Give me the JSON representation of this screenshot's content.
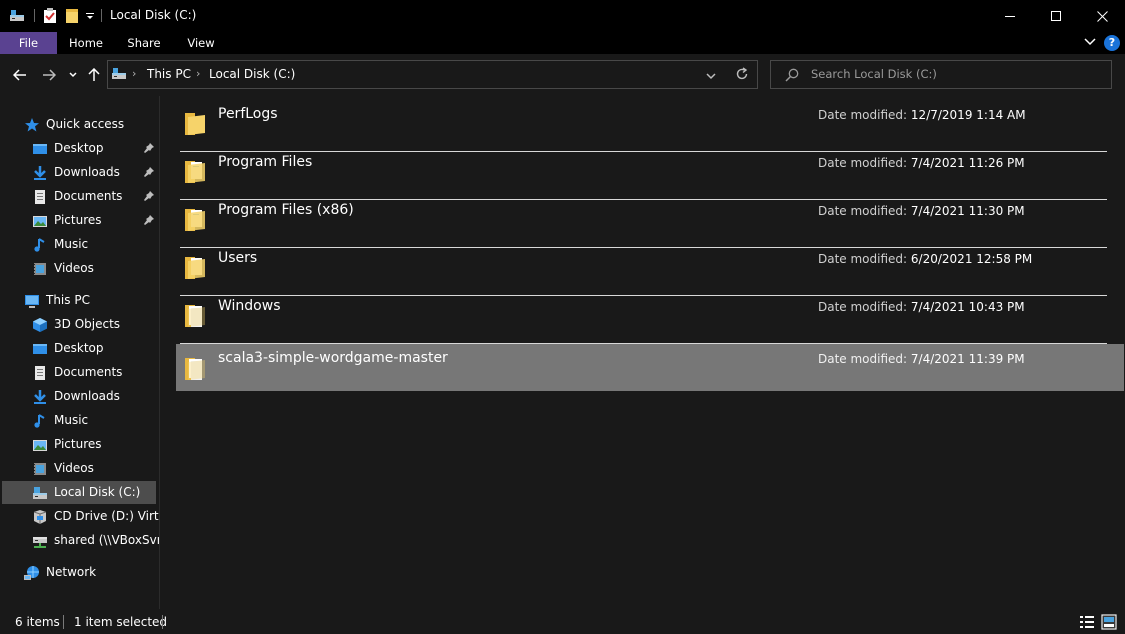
{
  "window": {
    "title": "Local Disk (C:)",
    "minimize_label": "—",
    "maximize_label": "☐",
    "close_label": "✕"
  },
  "ribbon": {
    "tabs": [
      "File",
      "Home",
      "Share",
      "View"
    ],
    "file_color": "#5a4291",
    "help_label": "?"
  },
  "address": {
    "crumbs": [
      "This PC",
      "Local Disk (C:)"
    ],
    "search_placeholder": "Search Local Disk (C:)"
  },
  "nav": {
    "quick_access": "Quick access",
    "quick_items": [
      {
        "label": "Desktop",
        "icon": "desktop-icon",
        "pinned": true
      },
      {
        "label": "Downloads",
        "icon": "downloads-icon",
        "pinned": true
      },
      {
        "label": "Documents",
        "icon": "documents-icon",
        "pinned": true
      },
      {
        "label": "Pictures",
        "icon": "pictures-icon",
        "pinned": true
      },
      {
        "label": "Music",
        "icon": "music-icon",
        "pinned": false
      },
      {
        "label": "Videos",
        "icon": "videos-icon",
        "pinned": false
      }
    ],
    "this_pc": "This PC",
    "pc_items": [
      {
        "label": "3D Objects",
        "icon": "3d-objects-icon"
      },
      {
        "label": "Desktop",
        "icon": "desktop-icon"
      },
      {
        "label": "Documents",
        "icon": "documents-icon"
      },
      {
        "label": "Downloads",
        "icon": "downloads-icon"
      },
      {
        "label": "Music",
        "icon": "music-icon"
      },
      {
        "label": "Pictures",
        "icon": "pictures-icon"
      },
      {
        "label": "Videos",
        "icon": "videos-icon"
      },
      {
        "label": "Local Disk (C:)",
        "icon": "drive-icon",
        "selected": true
      },
      {
        "label": "CD Drive (D:) Virtua",
        "icon": "cd-drive-icon"
      },
      {
        "label": "shared (\\\\VBoxSvr)",
        "icon": "network-drive-icon"
      }
    ],
    "network": "Network"
  },
  "files": {
    "date_label": "Date modified:",
    "items": [
      {
        "name": "PerfLogs",
        "date": "12/7/2019 1:14 AM",
        "selected": false
      },
      {
        "name": "Program Files",
        "date": "7/4/2021 11:26 PM",
        "selected": false
      },
      {
        "name": "Program Files (x86)",
        "date": "7/4/2021 11:30 PM",
        "selected": false
      },
      {
        "name": "Users",
        "date": "6/20/2021 12:58 PM",
        "selected": false
      },
      {
        "name": "Windows",
        "date": "7/4/2021 10:43 PM",
        "selected": false
      },
      {
        "name": "scala3-simple-wordgame-master",
        "date": "7/4/2021 11:39 PM",
        "selected": true
      }
    ]
  },
  "status": {
    "item_count": "6 items",
    "selected": "1 item selected"
  }
}
